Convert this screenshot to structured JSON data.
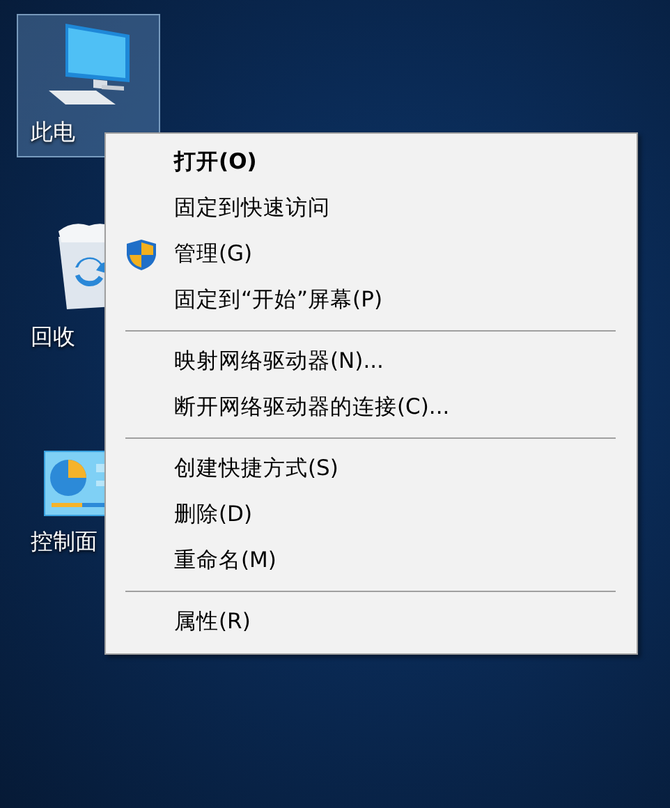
{
  "desktop": {
    "icons": [
      {
        "kind": "computer",
        "label": "此电",
        "selected": true
      },
      {
        "kind": "recycle-bin",
        "label": "回收",
        "selected": false
      },
      {
        "kind": "control-panel",
        "label": "控制面",
        "selected": false
      }
    ]
  },
  "context_menu": {
    "items": [
      {
        "kind": "item",
        "label": "打开(O)",
        "default": true
      },
      {
        "kind": "item",
        "label": "固定到快速访问",
        "default": false
      },
      {
        "kind": "admin-item",
        "label": "管理(G)",
        "default": false
      },
      {
        "kind": "item",
        "label": "固定到“开始”屏幕(P)",
        "default": false
      },
      {
        "kind": "separator"
      },
      {
        "kind": "item",
        "label": "映射网络驱动器(N)...",
        "default": false
      },
      {
        "kind": "item",
        "label": "断开网络驱动器的连接(C)...",
        "default": false
      },
      {
        "kind": "separator"
      },
      {
        "kind": "item",
        "label": "创建快捷方式(S)",
        "default": false
      },
      {
        "kind": "item",
        "label": "删除(D)",
        "default": false
      },
      {
        "kind": "item",
        "label": "重命名(M)",
        "default": false
      },
      {
        "kind": "separator"
      },
      {
        "kind": "item",
        "label": "属性(R)",
        "default": false
      }
    ]
  }
}
